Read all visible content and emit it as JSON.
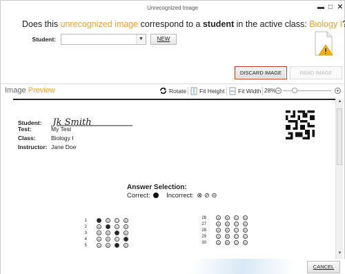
{
  "window": {
    "title": "Unrecognized Image"
  },
  "question": {
    "part1": "Does this ",
    "accent1": "unrecognized image",
    "part2": " correspond to a ",
    "bold": "student",
    "part3": " in the active class: ",
    "accent2": "Biology I",
    "part4": "?"
  },
  "student_select": {
    "label": "Student:",
    "value": "",
    "new_label": "NEW"
  },
  "buttons": {
    "discard": "DISCARD IMAGE",
    "read": "READ IMAGE",
    "cancel": "CANCEL"
  },
  "preview": {
    "title_part1": "Image ",
    "title_accent": "Preview",
    "rotate": "Rotate",
    "fit_height": "Fit Height",
    "fit_width": "Fit Width",
    "zoom": "28%"
  },
  "sheet": {
    "student_label": "Student:",
    "student_value": "Jk Smith",
    "test_label": "Test:",
    "test_value": "My Test",
    "class_label": "Class:",
    "class_value": "Biology I",
    "instructor_label": "Instructor:",
    "instructor_value": "Jane Doe",
    "answer_title": "Answer Selection:",
    "correct_label": "Correct:",
    "incorrect_label": "Incorrect:",
    "left_rows": [
      {
        "num": "1",
        "fill": [
          1,
          0,
          0,
          0
        ]
      },
      {
        "num": "2",
        "fill": [
          0,
          1,
          0,
          0
        ]
      },
      {
        "num": "3",
        "fill": [
          0,
          0,
          1,
          0
        ]
      },
      {
        "num": "4",
        "fill": [
          0,
          0,
          0,
          1
        ]
      },
      {
        "num": "5",
        "fill": [
          0,
          0,
          1,
          0
        ]
      }
    ],
    "right_rows": [
      {
        "num": "26",
        "fill": [
          0,
          0,
          0,
          0
        ]
      },
      {
        "num": "27",
        "fill": [
          0,
          0,
          0,
          0
        ]
      },
      {
        "num": "28",
        "fill": [
          0,
          0,
          0,
          0
        ]
      },
      {
        "num": "29",
        "fill": [
          0,
          0,
          0,
          0
        ]
      },
      {
        "num": "30",
        "fill": [
          0,
          0,
          0,
          0
        ]
      }
    ],
    "choices": [
      "A",
      "B",
      "C",
      "D"
    ]
  }
}
